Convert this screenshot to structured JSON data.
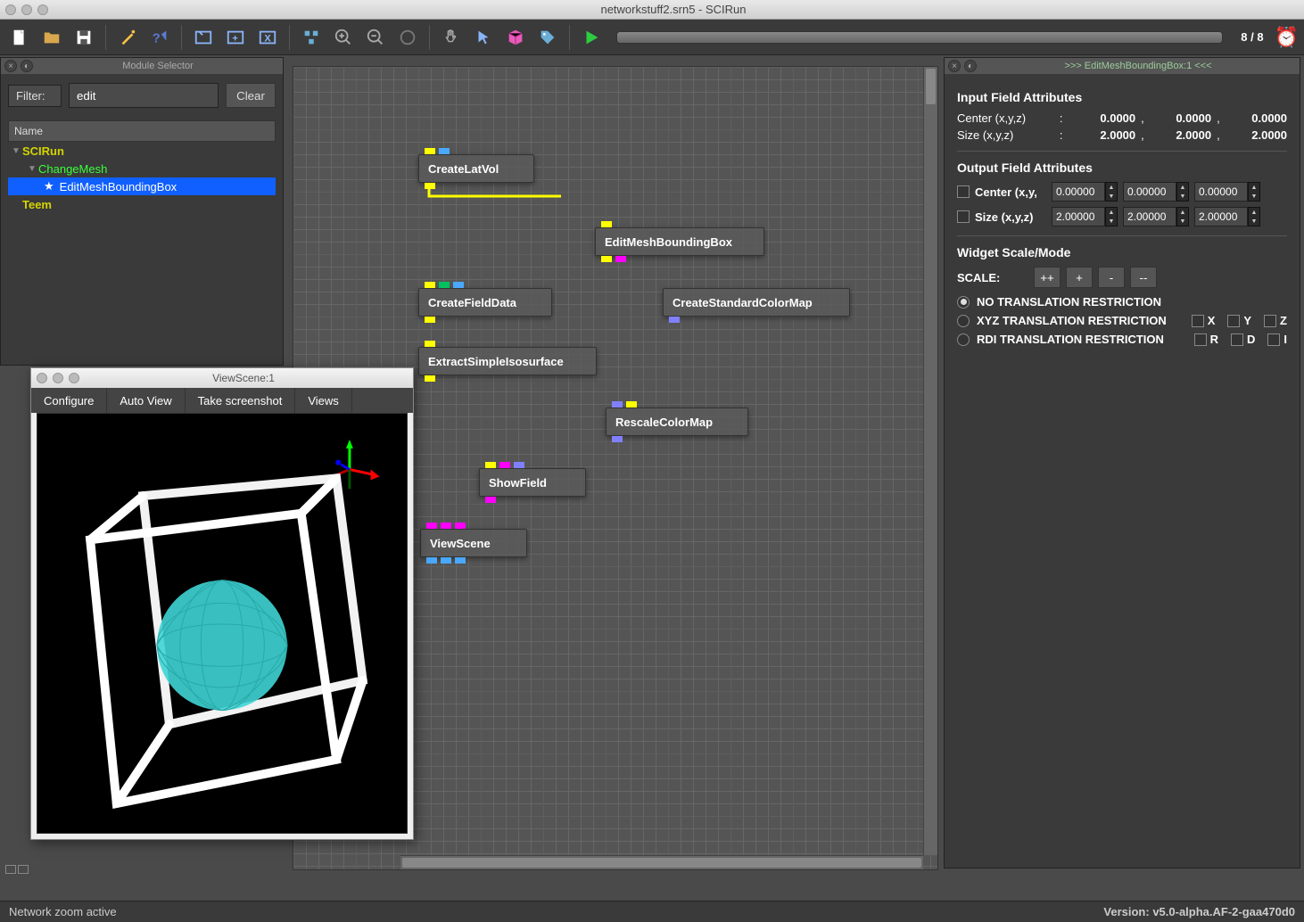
{
  "window": {
    "title": "networkstuff2.srn5 - SCIRun"
  },
  "toolbar": {
    "count": "8 / 8"
  },
  "module_selector": {
    "title": "Module Selector",
    "filter_label": "Filter:",
    "filter_value": "edit",
    "clear": "Clear",
    "header": "Name",
    "tree": {
      "root": "SCIRun",
      "child": "ChangeMesh",
      "leaf": "EditMeshBoundingBox",
      "sibling": "Teem"
    }
  },
  "canvas": {
    "nodes": {
      "createlatvol": "CreateLatVol",
      "editmesh": "EditMeshBoundingBox",
      "createfielddata": "CreateFieldData",
      "createcolormap": "CreateStandardColorMap",
      "extract": "ExtractSimpleIsosurface",
      "rescale": "RescaleColorMap",
      "showfield": "ShowField",
      "viewscene": "ViewScene"
    }
  },
  "view_win": {
    "title": "ViewScene:1",
    "btn_configure": "Configure",
    "btn_autoview": "Auto View",
    "btn_screenshot": "Take screenshot",
    "btn_views": "Views"
  },
  "prop": {
    "title": ">>> EditMeshBoundingBox:1 <<<",
    "input_header": "Input Field Attributes",
    "center_label": "Center (x,y,z)",
    "size_label": "Size (x,y,z)",
    "center_x": "0.0000",
    "center_y": "0.0000",
    "center_z": "0.0000",
    "size_x": "2.0000",
    "size_y": "2.0000",
    "size_z": "2.0000",
    "output_header": "Output Field Attributes",
    "out_center_label": "Center (x,y,",
    "out_size_label": "Size (x,y,z)",
    "oc_x": "0.00000",
    "oc_y": "0.00000",
    "oc_z": "0.00000",
    "os_x": "2.00000",
    "os_y": "2.00000",
    "os_z": "2.00000",
    "widget_header": "Widget Scale/Mode",
    "scale_label": "SCALE:",
    "scale_btns": {
      "pp": "++",
      "p": "+",
      "m": "-",
      "mm": "--"
    },
    "radio_none": "NO TRANSLATION RESTRICTION",
    "radio_xyz": "XYZ TRANSLATION RESTRICTION",
    "radio_rdi": "RDI TRANSLATION RESTRICTION",
    "axis": {
      "x": "X",
      "y": "Y",
      "z": "Z",
      "r": "R",
      "d": "D",
      "i": "I"
    }
  },
  "status": {
    "left": "Network zoom active",
    "right": "Version: v5.0-alpha.AF-2-gaa470d0"
  }
}
